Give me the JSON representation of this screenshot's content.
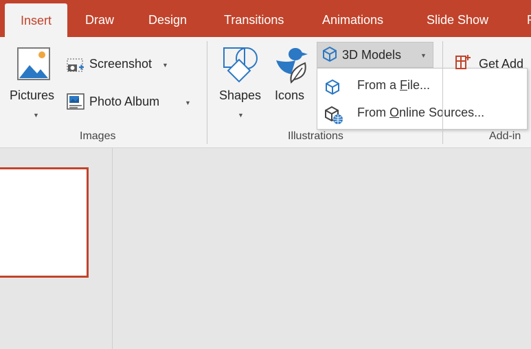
{
  "tabs": [
    "Insert",
    "Draw",
    "Design",
    "Transitions",
    "Animations",
    "Slide Show",
    "R"
  ],
  "ribbon": {
    "images": {
      "pictures": "Pictures",
      "screenshot": "Screenshot",
      "photo_album": "Photo Album",
      "group_label": "Images"
    },
    "illustrations": {
      "shapes": "Shapes",
      "icons": "Icons",
      "three_d_models": "3D Models",
      "group_label": "Illustrations"
    },
    "addins": {
      "get_addins": "Get Add",
      "group_label": "Add-in"
    }
  },
  "dropdown": {
    "from_file": {
      "pre": "From a ",
      "key": "F",
      "post": "ile..."
    },
    "from_online": {
      "pre": "From ",
      "key": "O",
      "post": "nline Sources..."
    }
  },
  "colors": {
    "accent": "#c1432b",
    "ribbon": "#f3f3f3",
    "icon_blue": "#2b78c4"
  }
}
